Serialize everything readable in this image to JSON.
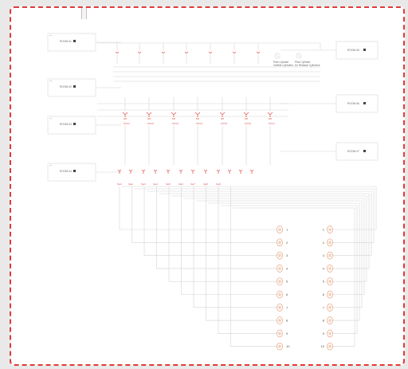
{
  "rooms_left": [
    "ROOM #1",
    "ROOM #2",
    "ROOM #3",
    "ROOM #4"
  ],
  "rooms_right": [
    "ROOM #5",
    "ROOM #6",
    "ROOM #7"
  ],
  "cylinders": [
    "Pilot Cylinder\nInhibits Cylinders",
    "Pilot Cylinder\nfor Release Cylinders"
  ],
  "valve_labels": [
    "SOV1",
    "SOV2",
    "SOV3",
    "SOV4",
    "SOV5",
    "SOV6",
    "SOV7"
  ],
  "switch_labels": [
    "Sw1",
    "Sw2",
    "Sw3",
    "Sw4",
    "Sw5",
    "Sw6",
    "Sw7",
    "Sw8",
    "Sw9"
  ],
  "connectors_left": [
    "1",
    "2",
    "3",
    "4",
    "5",
    "6",
    "7",
    "8",
    "9",
    "10"
  ],
  "connectors_right": [
    "1",
    "2",
    "3",
    "4",
    "5",
    "6",
    "7",
    "8",
    "9",
    "10"
  ],
  "colors": {
    "border": "#e03a3a",
    "accent": "#e24a4a",
    "wire": "#d4d4d4"
  }
}
